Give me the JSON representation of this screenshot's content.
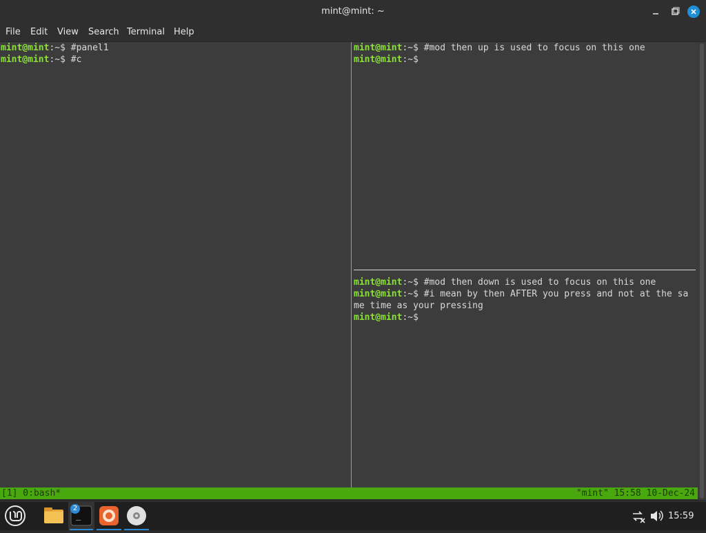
{
  "window": {
    "title": "mint@mint: ~",
    "controls": [
      "minimize-icon",
      "maximize-icon",
      "close-icon"
    ]
  },
  "menu": [
    "File",
    "Edit",
    "View",
    "Search",
    "Terminal",
    "Help"
  ],
  "panes": {
    "left": {
      "lines": [
        {
          "user": "mint@mint",
          "path": ":~$ ",
          "cmd": "#panel1"
        },
        {
          "user": "mint@mint",
          "path": ":~$ ",
          "cmd": "#c"
        }
      ]
    },
    "top_right": {
      "lines": [
        {
          "user": "mint@mint",
          "path": ":~$ ",
          "cmd": "#mod then up is used to focus on this one"
        },
        {
          "user": "mint@mint",
          "path": ":~$",
          "cmd": ""
        }
      ]
    },
    "bottom_right": {
      "lines": [
        {
          "user": "mint@mint",
          "path": ":~$ ",
          "cmd": "#mod then down is used to focus on this one"
        },
        {
          "user": "mint@mint",
          "path": ":~$ ",
          "cmd": "#i mean by then AFTER you press and not at the sa"
        },
        {
          "user": "",
          "path": "",
          "cmd": "me time as your pressing"
        },
        {
          "user": "mint@mint",
          "path": ":~$",
          "cmd": ""
        }
      ]
    }
  },
  "tmux_status": {
    "left": "[1] 0:bash*",
    "right": "\"mint\" 15:58 10-Dec-24"
  },
  "taskbar": {
    "apps": [
      "mint-menu-icon",
      "files-icon",
      "terminal-icon",
      "firefox-icon",
      "disc-icon"
    ],
    "terminal_badge": "2",
    "tray": [
      "network-icon",
      "volume-icon"
    ],
    "clock": "15:59"
  },
  "colors": {
    "prompt_user": "#8ae234",
    "tmux_bar": "#4aa80f",
    "terminal_bg": "#3c3c3c",
    "accent": "#1e90d6"
  }
}
